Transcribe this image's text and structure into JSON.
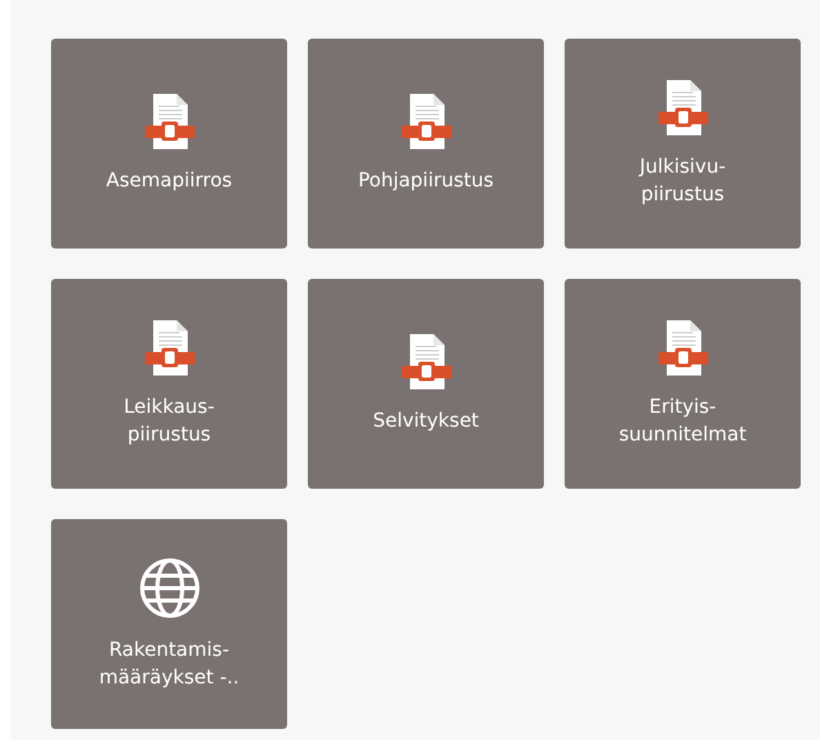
{
  "tiles": [
    {
      "kind": "document",
      "lines": [
        "Asemapiirros"
      ]
    },
    {
      "kind": "document",
      "lines": [
        "Pohjapiirustus"
      ]
    },
    {
      "kind": "document",
      "lines": [
        "Julkisivu-",
        "piirustus"
      ]
    },
    {
      "kind": "document",
      "lines": [
        "Leikkaus-",
        "piirustus"
      ]
    },
    {
      "kind": "document",
      "lines": [
        "Selvitykset"
      ]
    },
    {
      "kind": "document",
      "lines": [
        "Erityis-",
        "suunnitelmat"
      ]
    },
    {
      "kind": "web",
      "lines": [
        "Rakentamis-",
        "määräykset -.."
      ]
    }
  ]
}
